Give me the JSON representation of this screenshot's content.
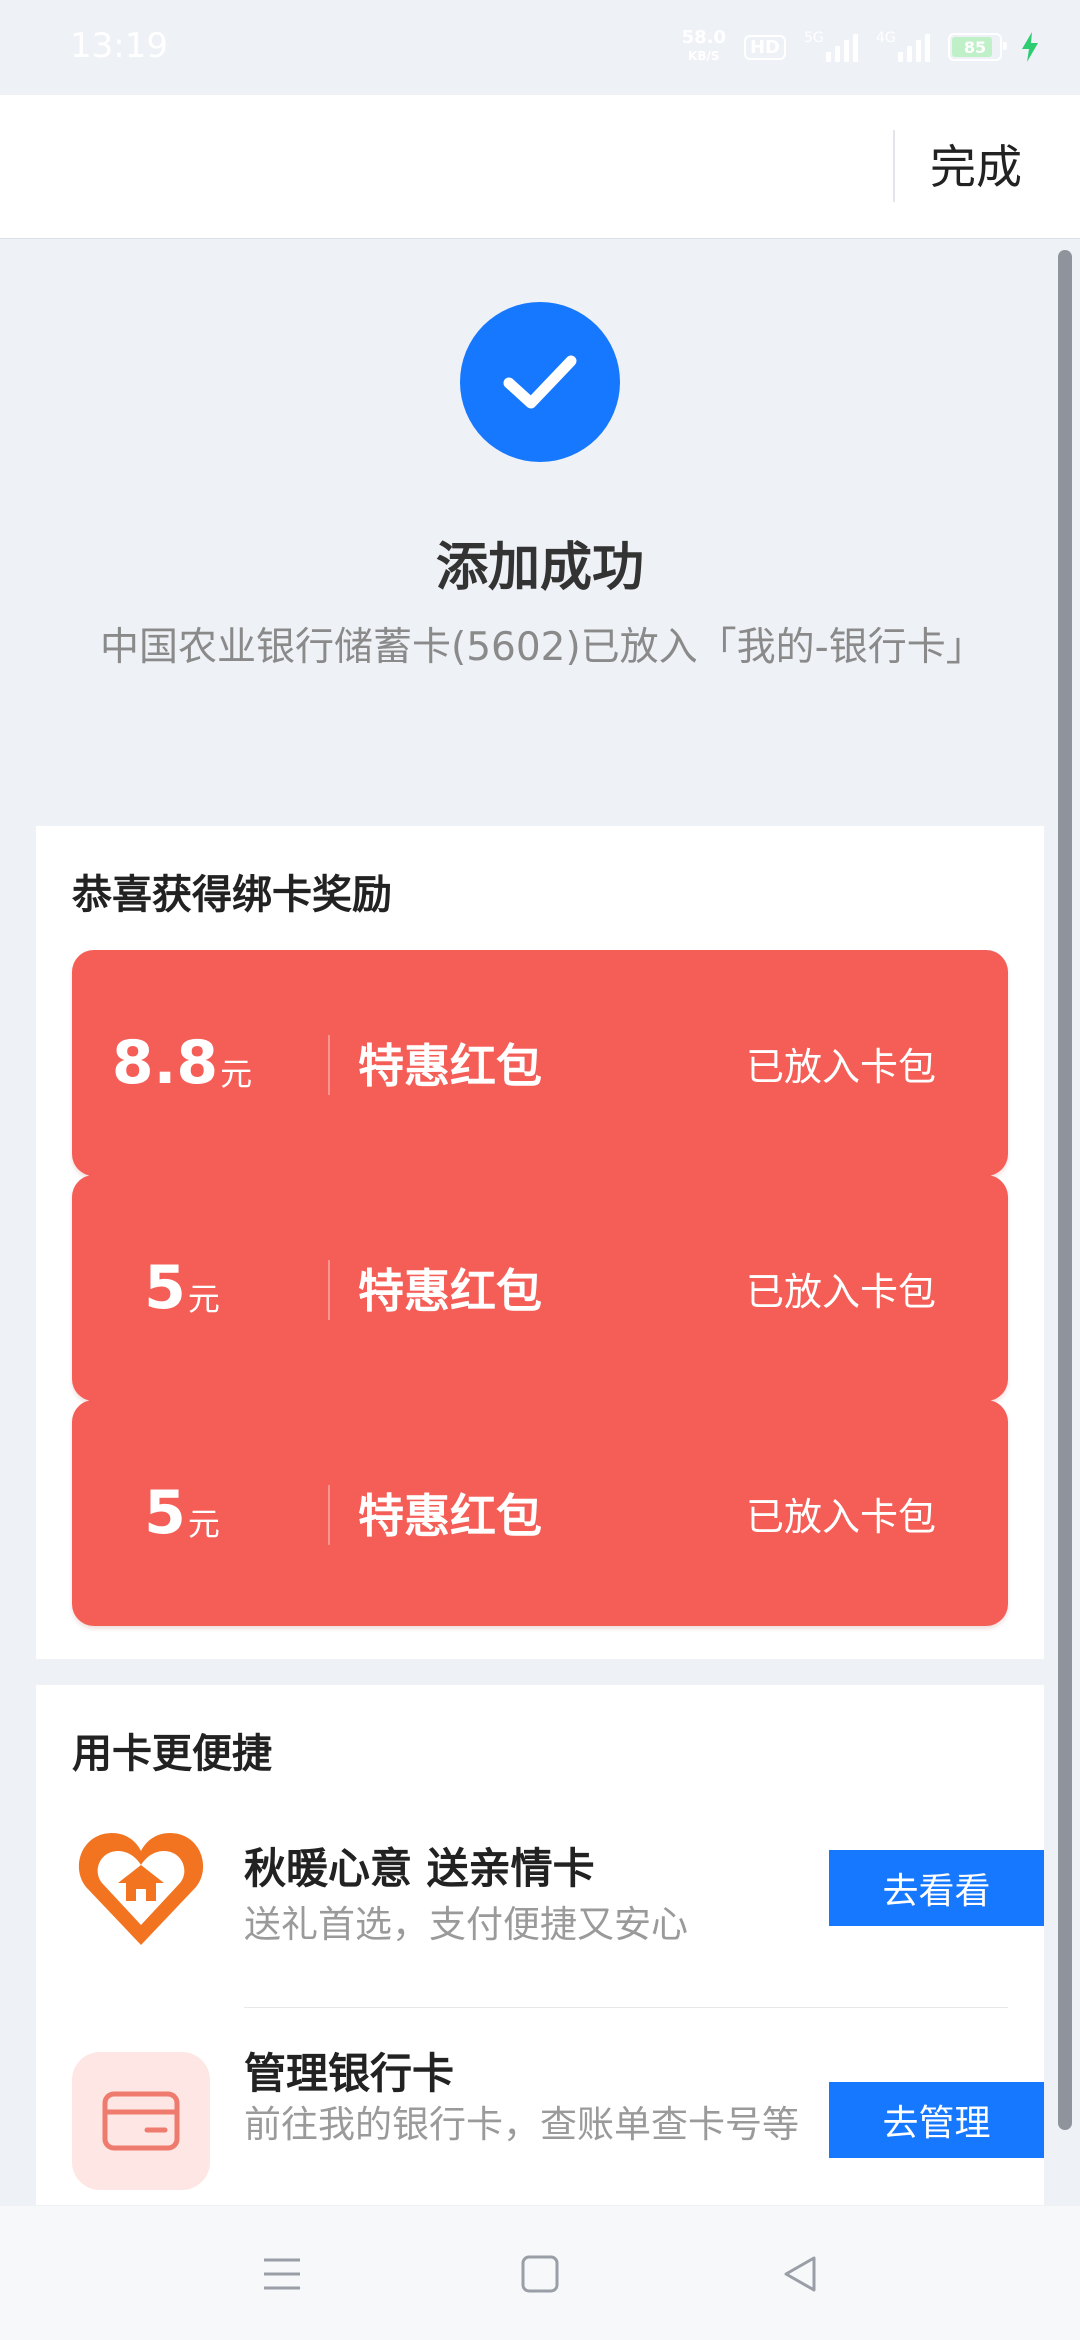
{
  "status_bar": {
    "time": "13:19",
    "net_speed_value": "58.0",
    "net_speed_unit": "KB/S",
    "hd_label": "HD",
    "signal_1_label": "5G",
    "signal_2_label": "4G",
    "battery_level": "85"
  },
  "header": {
    "done_label": "完成"
  },
  "success": {
    "title": "添加成功",
    "description": "中国农业银行储蓄卡(5602)已放入「我的-银行卡」"
  },
  "rewards": {
    "section_title": "恭喜获得绑卡奖励",
    "items": [
      {
        "amount": "8.8",
        "unit": "元",
        "name": "特惠红包",
        "status": "已放入卡包"
      },
      {
        "amount": "5",
        "unit": "元",
        "name": "特惠红包",
        "status": "已放入卡包"
      },
      {
        "amount": "5",
        "unit": "元",
        "name": "特惠红包",
        "status": "已放入卡包"
      }
    ]
  },
  "services": {
    "section_title": "用卡更便捷",
    "items": [
      {
        "title": "秋暖心意 送亲情卡",
        "subtitle": "送礼首选，支付便捷又安心",
        "button": "去看看",
        "icon": "gift-heart-icon"
      },
      {
        "title": "管理银行卡",
        "subtitle": "前往我的银行卡，查账单查卡号等",
        "button": "去管理",
        "icon": "bank-card-icon"
      }
    ]
  },
  "colors": {
    "accent_blue": "#1677ff",
    "coupon_red": "#f55d57",
    "background": "#eef1f6"
  },
  "nav": {
    "icons": [
      "menu-icon",
      "home-icon",
      "back-icon"
    ]
  }
}
